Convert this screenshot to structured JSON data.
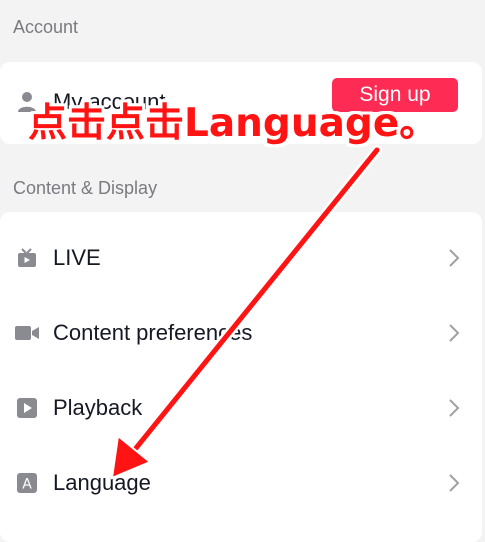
{
  "sections": {
    "account": "Account",
    "content_display": "Content & Display"
  },
  "account_row": {
    "label": "My account",
    "signup_label": "Sign up"
  },
  "settings_items": [
    {
      "label": "LIVE",
      "icon": "tv-icon"
    },
    {
      "label": "Content preferences",
      "icon": "video-camera-icon"
    },
    {
      "label": "Playback",
      "icon": "play-icon"
    },
    {
      "label": "Language",
      "icon": "language-a-icon"
    }
  ],
  "annotation": {
    "text": "点击点击Language。",
    "color": "#ff1313"
  },
  "colors": {
    "accent": "#fe2c55",
    "background": "#f3f3f4",
    "text": "#161823",
    "muted": "#7a7a80"
  }
}
